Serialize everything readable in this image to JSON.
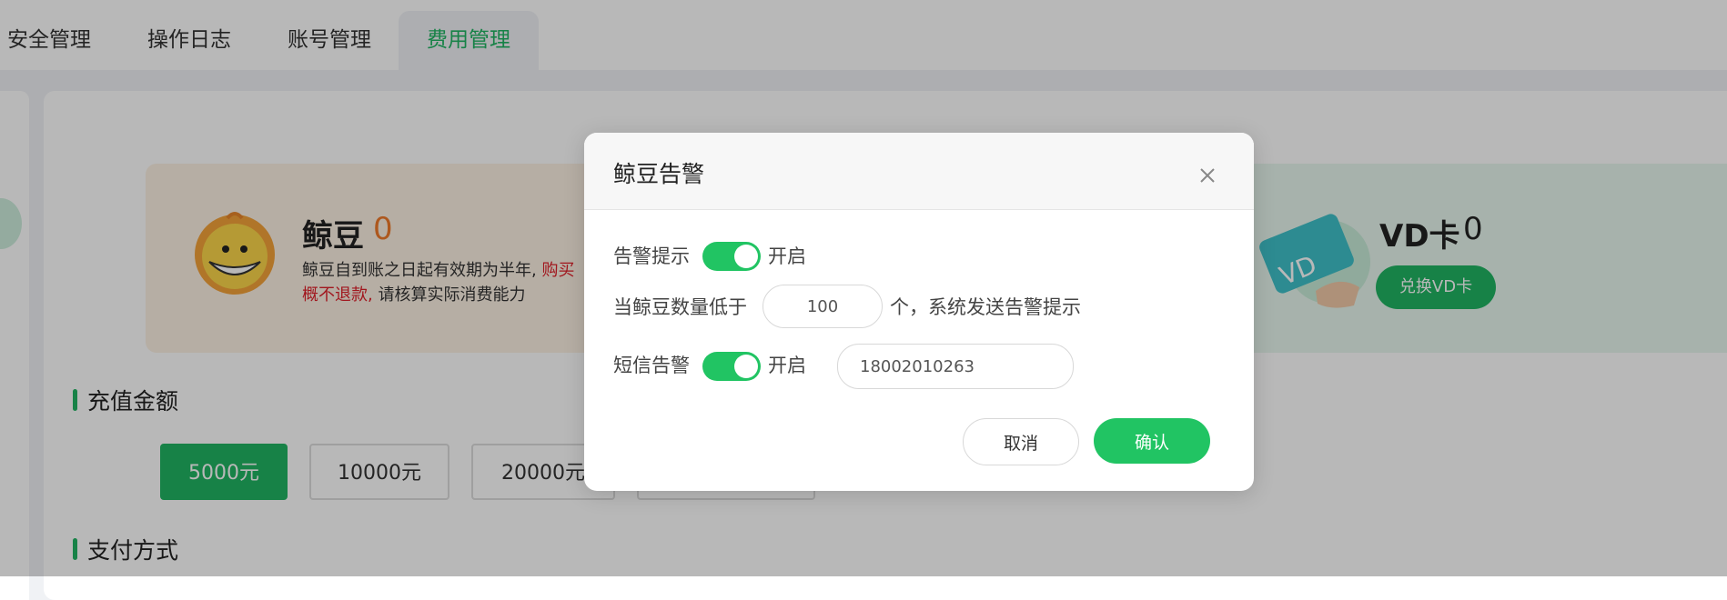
{
  "tabs": [
    {
      "label": "安全管理",
      "active": false
    },
    {
      "label": "操作日志",
      "active": false
    },
    {
      "label": "账号管理",
      "active": false
    },
    {
      "label": "费用管理",
      "active": true
    }
  ],
  "bean_card": {
    "title": "鲸豆",
    "count": "0",
    "desc_normal_1": "鲸豆自到账之日起有效期为半年,",
    "desc_red_1": "购买",
    "desc_red_2": "概不退款,",
    "desc_normal_2": "请核算实际消费能力"
  },
  "vd_card": {
    "title": "VD卡",
    "count": "0",
    "redeem_label": "兑换VD卡",
    "card_text": "VD"
  },
  "recharge": {
    "title": "充值金额",
    "amounts": [
      "5000元",
      "10000元",
      "20000元",
      ""
    ]
  },
  "payment": {
    "title": "支付方式"
  },
  "dialog": {
    "title": "鲸豆告警",
    "alert_label": "告警提示",
    "alert_state": "开启",
    "threshold_prefix": "当鲸豆数量低于",
    "threshold_value": "100",
    "threshold_suffix": "个，系统发送告警提示",
    "sms_label": "短信告警",
    "sms_state": "开启",
    "phone": "18002010263",
    "cancel_label": "取消",
    "confirm_label": "确认"
  },
  "colors": {
    "accent": "#21b563",
    "warning": "#e0202a",
    "bean_count": "#f07a2a"
  }
}
